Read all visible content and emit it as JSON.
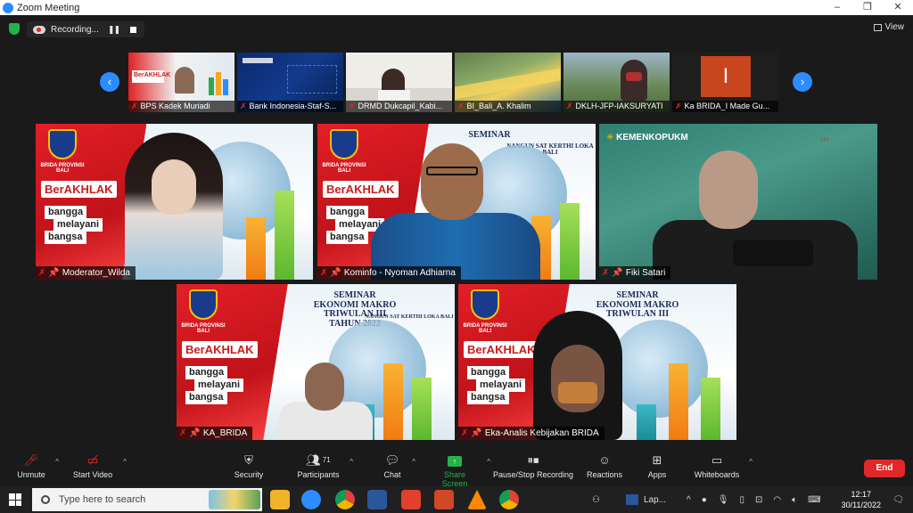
{
  "window": {
    "title": "Zoom Meeting",
    "controls": [
      "–",
      "❐",
      "✕"
    ]
  },
  "topbar": {
    "recording_label": "Recording...",
    "view_label": "View"
  },
  "thumbnails": [
    {
      "name": "BPS Kadek Muriadi"
    },
    {
      "name": "Bank Indonesia-Staf-S..."
    },
    {
      "name": "DRMD Dukcapil_Kabi..."
    },
    {
      "name": "BI_Bali_A. Khalim"
    },
    {
      "name": "DKLH-JFP-IAKSURYATI"
    },
    {
      "name": "Ka BRIDA_I Made Gu..."
    }
  ],
  "tiles": [
    {
      "name": "Moderator_Wilda"
    },
    {
      "name": "Kominfo - Nyoman Adhiarna"
    },
    {
      "name": "Fiki Satari"
    },
    {
      "name": "KA_BRIDA"
    },
    {
      "name": "Eka-Analis Kebijakan BRIDA"
    }
  ],
  "slide": {
    "brida": "BRIDA PROVINSI BALI",
    "berakhlak": "BerAKHLAK",
    "bangga": "bangga",
    "melayani": "melayani",
    "bangsa": "bangsa",
    "seminar": "SEMINAR",
    "ekonomi": "EKONOMI MAKRO",
    "triwulan": "TRIWULAN III",
    "tahun": "TAHUN 2022",
    "nangun": "NANGUN SAT KERTHI LOKA BALI"
  },
  "kemenkop": {
    "title": "KEMENKOPUKM"
  },
  "toolbar": {
    "unmute": "Unmute",
    "start_video": "Start Video",
    "security": "Security",
    "participants": "Participants",
    "participants_count": "71",
    "chat": "Chat",
    "share_screen": "Share Screen",
    "pause_stop": "Pause/Stop Recording",
    "reactions": "Reactions",
    "apps": "Apps",
    "whiteboards": "Whiteboards",
    "end": "End"
  },
  "taskbar": {
    "search_placeholder": "Type here to search",
    "app_label": "Lap...",
    "time": "12:17",
    "date": "30/11/2022"
  },
  "colors": {
    "zoom_blue": "#2d8cff",
    "end_red": "#e02828",
    "share_green": "#23b24b"
  }
}
